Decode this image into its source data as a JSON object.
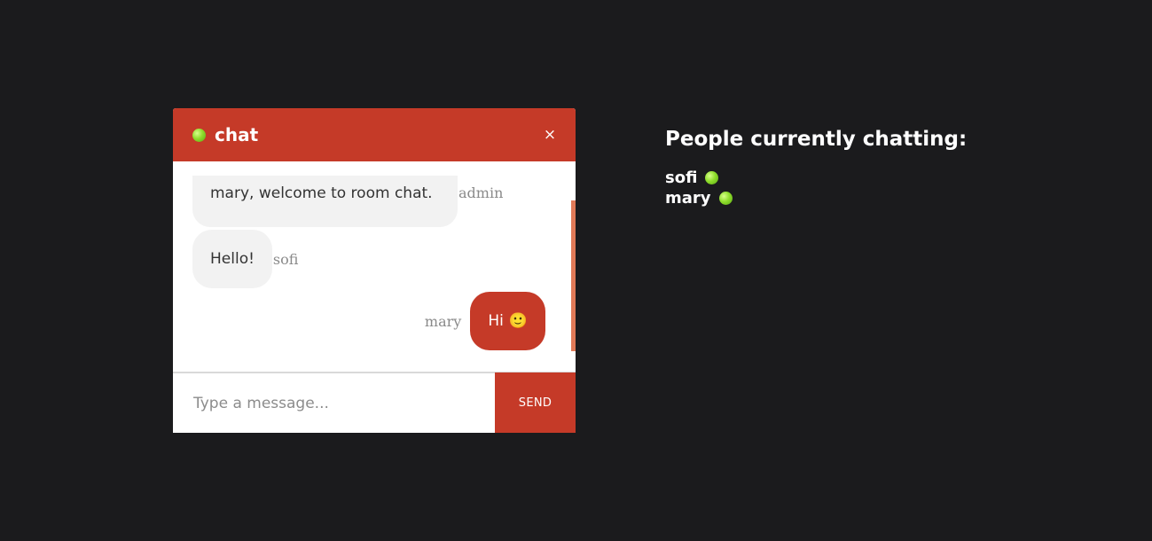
{
  "chat": {
    "title": "chat",
    "close_label": "×",
    "messages": [
      {
        "text": "mary, welcome to room chat.",
        "sender": "admin",
        "self": false
      },
      {
        "text": "Hello!",
        "sender": "sofi",
        "self": false
      },
      {
        "text": "Hi",
        "emoji": "🙂",
        "sender": "mary",
        "self": true
      }
    ],
    "input": {
      "value": "",
      "placeholder": "Type a message..."
    },
    "send_label": "SEND"
  },
  "people": {
    "title": "People currently chatting:",
    "list": [
      {
        "name": "sofi",
        "status": "online"
      },
      {
        "name": "mary",
        "status": "online"
      }
    ]
  },
  "colors": {
    "accent": "#c53a28",
    "background": "#1b1b1d",
    "online": "#8fdd2c",
    "bubble_other": "#f2f2f2"
  },
  "icons": {
    "close": "close-icon",
    "status": "online-status-icon"
  }
}
